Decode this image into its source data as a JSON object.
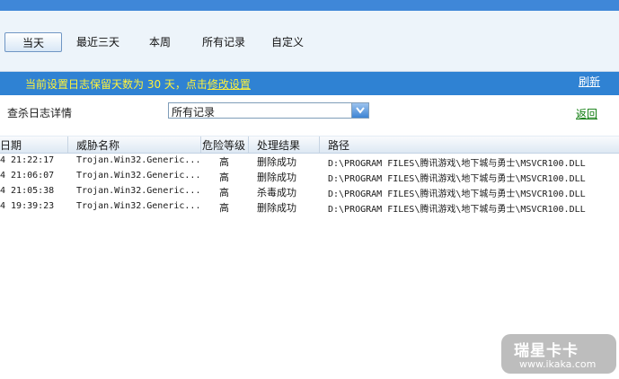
{
  "filters": {
    "tabs": [
      {
        "label": "当天",
        "active": true
      },
      {
        "label": "最近三天",
        "active": false
      },
      {
        "label": "本周",
        "active": false
      },
      {
        "label": "所有记录",
        "active": false
      },
      {
        "label": "自定义",
        "active": false
      }
    ]
  },
  "info": {
    "text": "当前设置日志保留天数为 30 天，点击",
    "link": "修改设置",
    "refresh": "刷新"
  },
  "search": {
    "label": "查杀日志详情",
    "selected": "所有记录",
    "back": "返回"
  },
  "table": {
    "columns": [
      "日期",
      "威胁名称",
      "危险等级",
      "处理结果",
      "路径"
    ],
    "rows": [
      [
        "4 21:22:17",
        "Trojan.Win32.Generic...",
        "高",
        "删除成功",
        "D:\\PROGRAM FILES\\腾讯游戏\\地下城与勇士\\MSVCR100.DLL"
      ],
      [
        "4 21:06:07",
        "Trojan.Win32.Generic...",
        "高",
        "删除成功",
        "D:\\PROGRAM FILES\\腾讯游戏\\地下城与勇士\\MSVCR100.DLL"
      ],
      [
        "4 21:05:38",
        "Trojan.Win32.Generic...",
        "高",
        "杀毒成功",
        "D:\\PROGRAM FILES\\腾讯游戏\\地下城与勇士\\MSVCR100.DLL"
      ],
      [
        "4 19:39:23",
        "Trojan.Win32.Generic...",
        "高",
        "删除成功",
        "D:\\PROGRAM FILES\\腾讯游戏\\地下城与勇士\\MSVCR100.DLL"
      ]
    ]
  },
  "watermark": {
    "logo": "瑞星卡卡",
    "url": "www.ikaka.com"
  },
  "colors": {
    "accent": "#2f82d3",
    "info_text": "#fff23a",
    "back_link": "#0a7a0a"
  }
}
